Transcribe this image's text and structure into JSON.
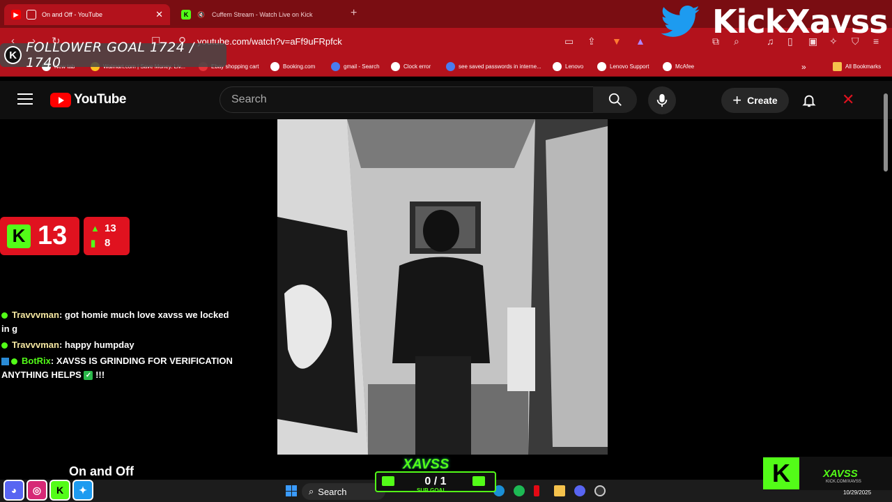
{
  "browser": {
    "tabs": [
      {
        "title": "On and Off - YouTube",
        "active": true
      },
      {
        "title": "Cuffem Stream - Watch Live on Kick",
        "active": false
      }
    ],
    "url": "youtube.com/watch?v=aFf9uFRpfck",
    "bookmarks": [
      "New tab",
      "Walmart.com | Save Money. Liv...",
      "Ebay shopping cart",
      "Booking.com",
      "gmail - Search",
      "Clock error",
      "see saved passwords in interne...",
      "Lenovo",
      "Lenovo Support",
      "McAfee"
    ],
    "all_bookmarks": "All Bookmarks"
  },
  "overlay": {
    "follower_goal": "FOLLOWER GOAL 1724 / 1740",
    "brand": "KickXavss",
    "kick_viewers": "13",
    "stat_up": "13",
    "stat_bars": "8",
    "sub_goal_name": "XAVSS",
    "sub_goal_value": "0 / 1",
    "sub_goal_label": "SUB GOAL",
    "xavss_name": "XAVSS",
    "xavss_url": "KICK.COM/XAVSS"
  },
  "youtube": {
    "logo_text": "YouTube",
    "search_placeholder": "Search",
    "create_label": "Create",
    "video_title": "On and Off"
  },
  "chat": [
    {
      "user": "Travvvman",
      "text": ": got homie much love xavss we locked in g"
    },
    {
      "user": "Travvvman",
      "text": ": happy humpday"
    },
    {
      "user": "BotRix",
      "text": ": XAVSS IS GRINDING FOR VERIFICATION ANYTHING HELPS",
      "suffix": " !!!"
    }
  ],
  "taskbar": {
    "search_label": "Search",
    "date": "10/29/2025"
  },
  "colors": {
    "chrome_red": "#b3121c",
    "kick_green": "#53fc18",
    "yt_red": "#ff0000"
  }
}
